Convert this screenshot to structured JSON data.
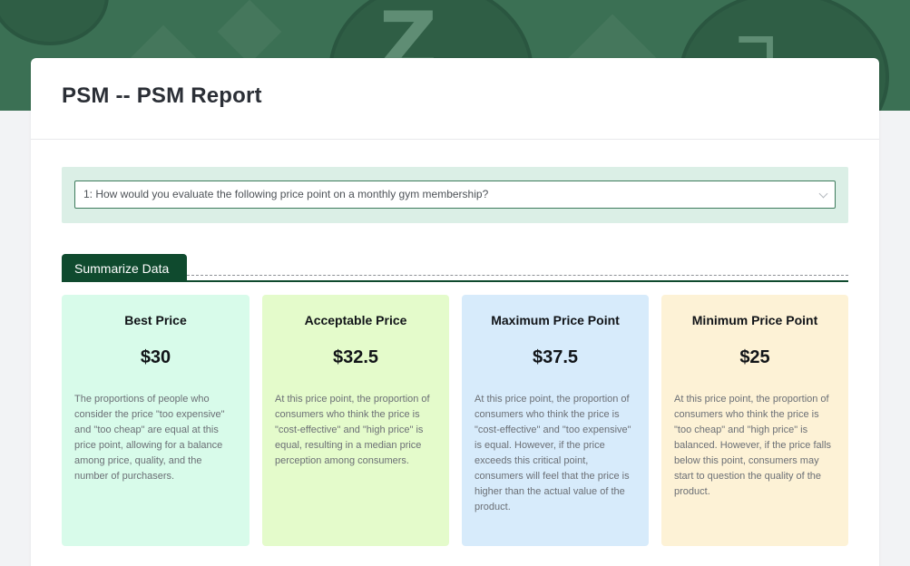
{
  "colors": {
    "banner": "#3b7054",
    "accent": "#0f4a2e",
    "panel": "#dbefe6",
    "card_best": "#d8fbea",
    "card_acceptable": "#e4fbcb",
    "card_max": "#d7ebfb",
    "card_min": "#fdf2d6"
  },
  "page": {
    "title": "PSM -- PSM Report"
  },
  "question": {
    "selected": "1: How would you evaluate the following price point on a monthly gym membership?",
    "icon": "chevron-down-icon"
  },
  "section": {
    "tab_label": "Summarize Data"
  },
  "metrics": [
    {
      "title": "Best Price",
      "value": "$30",
      "description": "The proportions of people who consider the price \"too expensive\" and \"too cheap\" are equal at this price point, allowing for a balance among price, quality, and the number of purchasers."
    },
    {
      "title": "Acceptable Price",
      "value": "$32.5",
      "description": "At this price point, the proportion of consumers who think the price is \"cost-effective\" and \"high price\" is equal, resulting in a median price perception among consumers."
    },
    {
      "title": "Maximum Price Point",
      "value": "$37.5",
      "description": "At this price point, the proportion of consumers who think the price is \"cost-effective\" and \"too expensive\" is equal. However, if the price exceeds this critical point, consumers will feel that the price is higher than the actual value of the product."
    },
    {
      "title": "Minimum Price Point",
      "value": "$25",
      "description": "At this price point, the proportion of consumers who think the price is \"too cheap\" and \"high price\" is balanced. However, if the price falls below this point, consumers may start to question the quality of the product."
    }
  ]
}
